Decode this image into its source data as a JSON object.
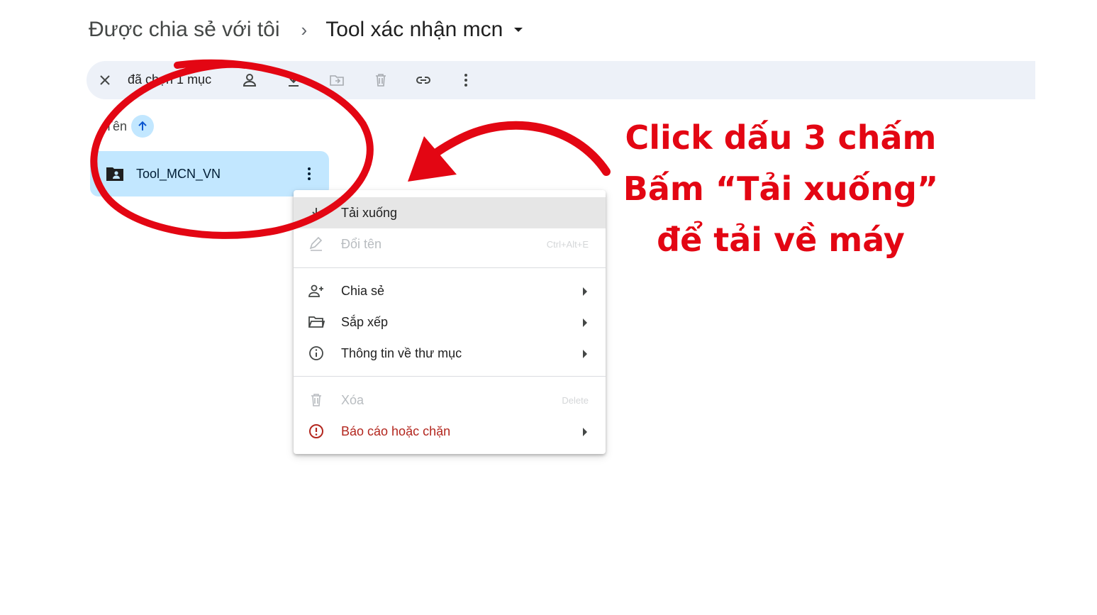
{
  "breadcrumb": {
    "root": "Được chia sẻ với tôi",
    "separator": "›",
    "current": "Tool xác nhận mcn"
  },
  "toolbar": {
    "selected_label": "đã chọn 1 mục",
    "icons": [
      "close-icon",
      "share-person-icon",
      "download-icon",
      "move-to-folder-icon",
      "trash-icon",
      "link-icon",
      "more-vert-icon"
    ]
  },
  "list": {
    "sort_label": "Tên",
    "sort_icon": "arrow-up-icon",
    "files": [
      {
        "name": "Tool_MCN_VN",
        "icon": "shared-folder-icon"
      }
    ]
  },
  "context_menu": {
    "items": [
      {
        "label": "Tải xuống",
        "icon": "download-icon",
        "state": "hover"
      },
      {
        "label": "Đổi tên",
        "icon": "rename-pencil-icon",
        "shortcut": "Ctrl+Alt+E",
        "state": "disabled"
      },
      {
        "label": "Chia sẻ",
        "icon": "person-add-icon",
        "submenu": true
      },
      {
        "label": "Sắp xếp",
        "icon": "folder-open-icon",
        "submenu": true
      },
      {
        "label": "Thông tin về thư mục",
        "icon": "info-icon",
        "submenu": true
      },
      {
        "label": "Xóa",
        "icon": "trash-icon",
        "shortcut": "Delete",
        "state": "disabled"
      },
      {
        "label": "Báo cáo hoặc chặn",
        "icon": "report-icon",
        "submenu": true,
        "state": "danger"
      }
    ]
  },
  "annotation": {
    "lines": [
      "Click dấu 3 chấm",
      "Bấm “Tải xuống”",
      "để tải về máy"
    ],
    "color": "#e30613"
  },
  "colors": {
    "toolbar_bg": "#edf1f8",
    "selected_row": "#c2e7ff",
    "accent_blue": "#0b57d0",
    "menu_hover": "#e6e6e6",
    "danger": "#b3261e"
  }
}
